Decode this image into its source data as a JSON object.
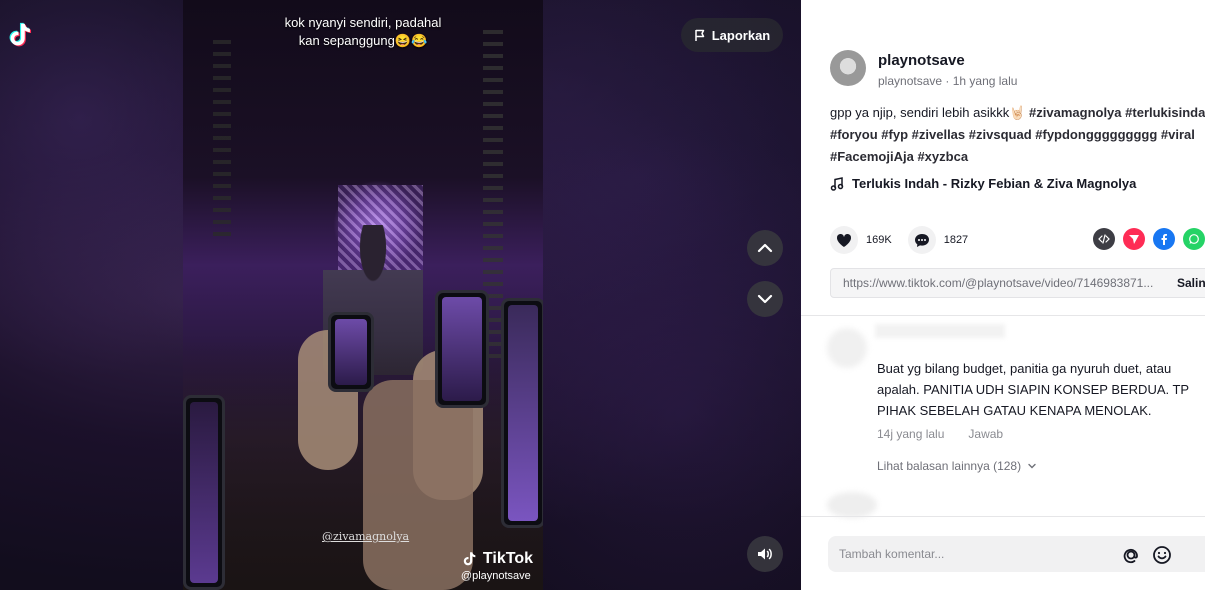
{
  "video": {
    "caption_line1": "kok nyanyi sendiri, padahal",
    "caption_line2": "kan sepanggung😆😂",
    "overlay_handle": "@zivamagnolya",
    "watermark_brand": "TikTok",
    "watermark_handle": "@playnotsave",
    "report_label": "Laporkan"
  },
  "post": {
    "author_name": "playnotsave",
    "author_sub": "playnotsave · 1h yang lalu",
    "desc_text": "gpp ya njip, sendiri lebih asikkk🤘🏻",
    "hashtags_line1": [
      "#zivamagnolya",
      "#terlukisindah"
    ],
    "hashtags_line2": [
      "#foryou",
      "#fyp",
      "#zivellas",
      "#zivsquad",
      "#fypdonggggggggg",
      "#viral"
    ],
    "hashtags_line3": [
      "#FacemojiAja",
      "#xyzbca"
    ],
    "music": "Terlukis Indah - Rizky Febian & Ziva Magnolya",
    "likes": "169K",
    "comments_count": "1827",
    "link": "https://www.tiktok.com/@playnotsave/video/7146983871...",
    "copy_label": "Salin"
  },
  "comment": {
    "text": "Buat yg bilang budget, panitia ga nyuruh duet, atau apalah. PANITIA UDH SIAPIN KONSEP BERDUA. TP PIHAK SEBELAH GATAU KENAPA MENOLAK.",
    "time": "14j yang lalu",
    "reply_label": "Jawab",
    "more_replies": "Lihat balasan lainnya (128)"
  },
  "input": {
    "placeholder": "Tambah komentar..."
  },
  "colors": {
    "accent": "#fe2c55",
    "facebook": "#1877f2",
    "whatsapp": "#25d366",
    "embed": "#3d3d44"
  }
}
